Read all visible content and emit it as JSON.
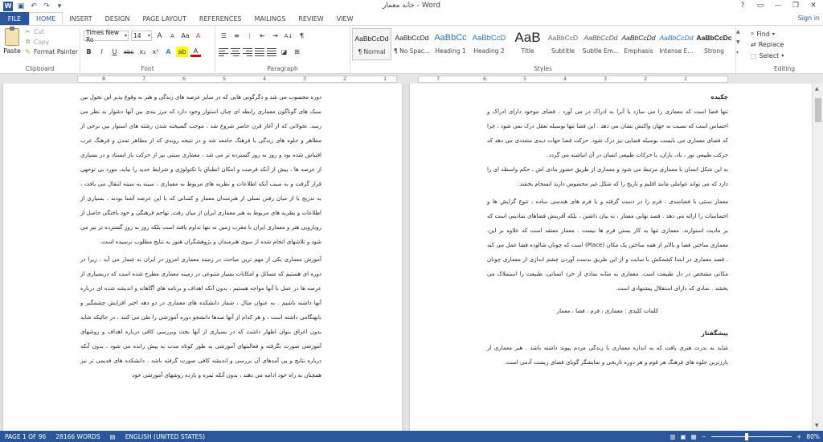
{
  "window": {
    "title": "خانه معمار - Word",
    "help": "?",
    "minimize": "—",
    "restore": "❐",
    "close": "✕",
    "signin": "Sign in"
  },
  "qat": {
    "save_icon": "save-icon",
    "undo_icon": "undo-icon",
    "redo_icon": "redo-icon"
  },
  "tabs": [
    "FILE",
    "HOME",
    "INSERT",
    "DESIGN",
    "PAGE LAYOUT",
    "REFERENCES",
    "MAILINGS",
    "REVIEW",
    "VIEW"
  ],
  "clipboard": {
    "label": "Clipboard",
    "paste": "Paste",
    "cut": "Cut",
    "copy": "Copy",
    "format_painter": "Format Painter"
  },
  "font": {
    "label": "Font",
    "name": "Times New Ro",
    "size": "14",
    "bold": "B",
    "italic": "I",
    "underline": "U",
    "strike": "abc",
    "sub": "x₂",
    "sup": "x²",
    "grow": "A",
    "shrink": "A",
    "case": "Aa",
    "clear": "A",
    "highlight": "ab",
    "color": "A"
  },
  "paragraph": {
    "label": "Paragraph",
    "pilcrow": "¶",
    "sort": "A↓"
  },
  "styles": {
    "label": "Styles",
    "items": [
      {
        "sample": "AaBbCcDd",
        "name": "¶ Normal"
      },
      {
        "sample": "AaBbCcDd",
        "name": "¶ No Spac..."
      },
      {
        "sample": "AaBbCc",
        "name": "Heading 1"
      },
      {
        "sample": "AaBbCcD",
        "name": "Heading 2"
      },
      {
        "sample": "AaB",
        "name": "Title"
      },
      {
        "sample": "AaBbCcD",
        "name": "Subtitle"
      },
      {
        "sample": "AaBbCcDd",
        "name": "Subtle Em..."
      },
      {
        "sample": "AaBbCcDd",
        "name": "Emphasis"
      },
      {
        "sample": "AaBbCcDd",
        "name": "Intense E..."
      },
      {
        "sample": "AaBbCcDc",
        "name": "Strong"
      }
    ]
  },
  "editing": {
    "label": "Editing",
    "find": "Find",
    "replace": "Replace",
    "select": "Select"
  },
  "ruler": {
    "left_numbers": [
      "1",
      "2",
      "3",
      "4",
      "5",
      "6",
      "7",
      "8"
    ],
    "right_numbers": [
      "1",
      "2",
      "3",
      "4",
      "5",
      "6",
      "7"
    ]
  },
  "left_page": {
    "paragraphs": [
      "دوره محسوب می شد و دگرگونی هایی که در سایر عرصه های زندگی و هنر به وقوع پذیر این تحول بین سبک های گوناگون معماری رابطه ای چنان استوار وجود دارد که مرز بندی بین آنها دشوار به نظر می رسد. تحولاتی که از آغاز قرن حاضر شروع شد ، موجب گسیخته شدن رشته های استوار بین برخی از مظاهر و جلوه های زندگی با فرهنگ جامعه شد و در نتیجه روندی که از مظاهر تمدن و فرهنگ غرب اقتباس شده بود و روز به روز گسترده تر می شد ، معماری سنتی نیز از حرکت باز ایستاد و در بسیاری از عرصه ها ، پیش از آنکه فرصت و امکان انطباق با تکنولوژی و شرایط جدید را بیابد، مورد بی توجهی قرار گرفت و به سبب آنکه اطلاعات و نظریه های مربوط به معماری ، سینه به سینه انتقال می یافت ، به تدریج با از میان رفتن نسلی از هنرمندان معمار و کسانی که با این عرصه آشنا بودند ، بسیاری از اطلاعات و نظریه های مربوط به هنر معماری ایران از میان رفت. تهاجم فرهنگی و خود باختگی حاصل از رویارویی هنر و معماری ایران با مغرب زمین نه تنها تداوم یافته است بلکه روز به روز گسترده تر نیز می شود و تلاشهای انجام شده از سوی هنرمندان و پژوهشگران هنوز به نتایج مطلوب نرسیده است.",
      "آموزش معماری یکی از مهم ترین مباحث در زمینه معماری امروز در ایران به شمار می آید ، زیرا در دوره ای هستیم که مسائل و امکانات بسیار متنوعی در زمینه معماری مطرح شده است که دربسیاری از عرصه ها در عمل با آنها مواجه هستیم ، بدون آنکه اهداف و برنامه های آگاهانه و اندیشه شده ای درباره آنها داشته باشیم . به عنوان مثال ، شمار دانشکده های معماری در دو دهه اخیر افزایش چشمگیر و نابهنگامی داشته است ، و هر کدام از آنها صدها دانشجو دوره آموزشی را طی می کنند ، در حالیکه شاید بدون اغراق بتوان اظهار داشت که در بسیاری از آنها بحث وبررسی کافی درباره اهداف و روشهای آموزشی صورت نگرفته و فعالیتهای آموزشی به طور کوتاه مدت به پیش رانده می شود ، بدون آنکه درباره نتایج و پی آمدهای آن بررسی و اندیشه کافی صورت گرفته باشد . دانشکده های قدیمی تر نیز همچنان به راه خود ادامه می دهند ، بدون آنکه ثمره و بازده روشهای آموزشی خود"
    ]
  },
  "right_page": {
    "abstract_heading": "چکیده",
    "paragraphs": [
      "تنها فضا است که معماری را می سازد یا آنرا به ادراک در می آورد . فضای موجود دارای ادراک و احساس است که نسبت به جهان واکنش نشان می دهد . این فضا تنها بوسیله تعقل درک نمی شود ، چرا که فضای معماری می بایست بوسیله فضایی نیز درک شود. حرکت فضا جهات دیدی متعددی می دهد که حرکت طبیعی نور ، باد، باران، یا حرکات طبیعی انسان در آن انباشته می گردد.",
      "به این شکل انسان با معماری مرتبط می شود و معماری از طریق حضور مادی اش ، حکم واسطه ای را دارد که می تواند عواملی مانند اقلیم و تاریخ را که شکل غیر محسوس دارند انسجام بخشد.",
      "معمار سنتی با فضامندی ، فرم را در دست گرفته و با فرم های هندسی ساده ، تنوع گرایش ها و احساسات را ارائه می دهد . قصد نهایی معمار ، نه بیان داشتن ، بلکه آفرینش فضاهای نمادینی است که بر مادیت استوارند. معماری تنها به کار بستن فرم ها نیست . معمار معتقد است که علاوه بر این، معماری ساختن فضا و بالاتر از همه ساختن یک مکان (Place) است که چونان شالوده فضا عمل می کند . قصد معماری در ابتدا کشمکش با سایت و از این طریق بدست آوردن چشم اندازی از معماری چونان مکانی مشخص در دل طبیعت است. معماری به مثابه نمادی از خرد انسانی، طبیعت را استملاک می بخشد . نمادی که دارای استقلال پیشنهادی است."
    ],
    "keywords": "کلمات کلیدی : معماری ، فرم ، فضا ، معمار",
    "intro_heading": "پیشگفتار",
    "intro": "شاید به ندرت هنری یافت که به اندازه معماری با زندگی مردم پیوند داشته باشد . هنر معماری از بارزترین جلوه های فرهنگ هر قوم و هر دوره تاریخی و نمایشگر گویای فضای زیست آدمی است."
  },
  "status": {
    "page": "PAGE 1 OF 96",
    "words": "28166 WORDS",
    "language": "ENGLISH (UNITED STATES)",
    "zoom_minus": "−",
    "zoom_plus": "+",
    "zoom": "80%"
  }
}
